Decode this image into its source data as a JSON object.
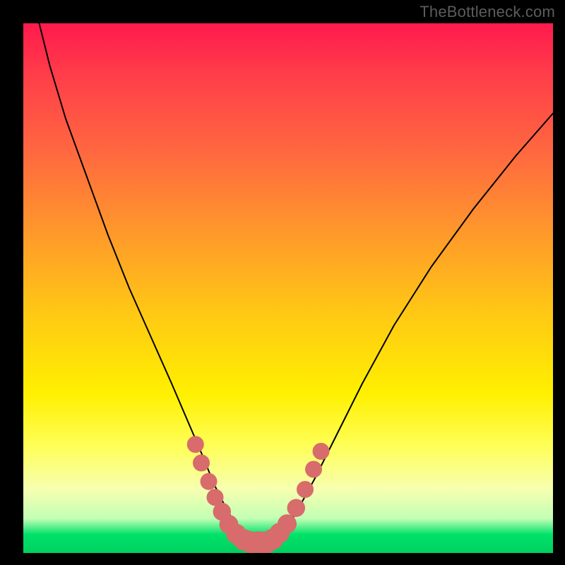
{
  "watermark": "TheBottleneck.com",
  "chart_data": {
    "type": "line",
    "title": "",
    "xlabel": "",
    "ylabel": "",
    "xlim": [
      0,
      100
    ],
    "ylim": [
      0,
      100
    ],
    "series": [
      {
        "name": "bottleneck-curve",
        "x": [
          3,
          5,
          8,
          12,
          16,
          20,
          24,
          28,
          31,
          34,
          36,
          38,
          40,
          42,
          44,
          46,
          48,
          50,
          52,
          55,
          59,
          64,
          70,
          77,
          85,
          93,
          100
        ],
        "values": [
          100,
          92,
          82,
          71,
          60,
          50,
          41,
          32,
          25,
          18,
          13,
          9,
          5.5,
          3.2,
          2.0,
          2.0,
          3.0,
          5.0,
          8.5,
          14,
          22,
          32,
          43,
          54,
          65,
          75,
          83
        ]
      }
    ],
    "markers": {
      "name": "highlighted-points",
      "color": "#d86b6b",
      "points": [
        {
          "x": 32.5,
          "y": 20.5,
          "r": 1.6
        },
        {
          "x": 33.6,
          "y": 17.0,
          "r": 1.6
        },
        {
          "x": 35.0,
          "y": 13.5,
          "r": 1.6
        },
        {
          "x": 36.2,
          "y": 10.5,
          "r": 1.6
        },
        {
          "x": 37.5,
          "y": 7.8,
          "r": 1.7
        },
        {
          "x": 38.8,
          "y": 5.4,
          "r": 1.8
        },
        {
          "x": 40.2,
          "y": 3.6,
          "r": 1.9
        },
        {
          "x": 41.6,
          "y": 2.5,
          "r": 2.0
        },
        {
          "x": 43.0,
          "y": 2.0,
          "r": 2.1
        },
        {
          "x": 44.4,
          "y": 2.0,
          "r": 2.1
        },
        {
          "x": 45.8,
          "y": 2.0,
          "r": 2.1
        },
        {
          "x": 47.1,
          "y": 2.6,
          "r": 2.0
        },
        {
          "x": 48.4,
          "y": 3.8,
          "r": 1.9
        },
        {
          "x": 49.8,
          "y": 5.5,
          "r": 1.8
        },
        {
          "x": 51.5,
          "y": 8.5,
          "r": 1.7
        },
        {
          "x": 53.2,
          "y": 12.0,
          "r": 1.6
        },
        {
          "x": 54.8,
          "y": 15.8,
          "r": 1.6
        },
        {
          "x": 56.2,
          "y": 19.2,
          "r": 1.6
        }
      ]
    }
  }
}
